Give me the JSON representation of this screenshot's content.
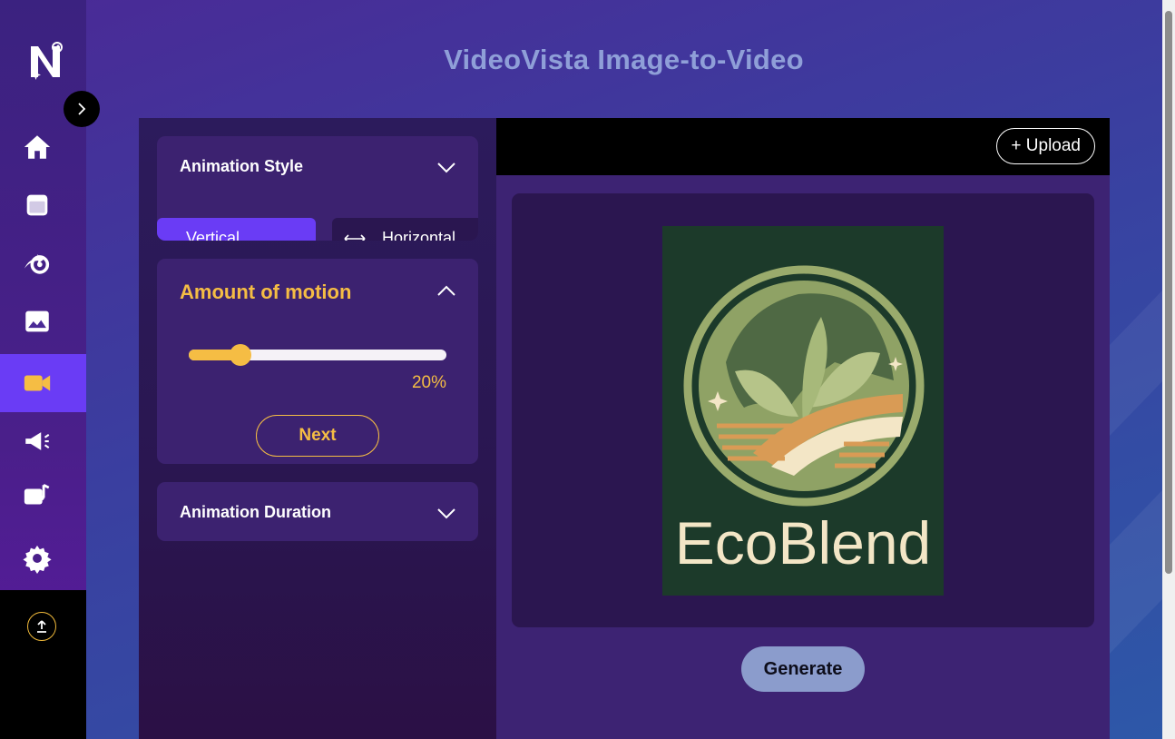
{
  "app": {
    "title": "VideoVista Image-to-Video"
  },
  "sidebar": {
    "items": [
      {
        "icon": "home-icon"
      },
      {
        "icon": "calendar-icon"
      },
      {
        "icon": "automation-gear-icon"
      },
      {
        "icon": "image-icon"
      },
      {
        "icon": "video-camera-icon",
        "active": true
      },
      {
        "icon": "megaphone-icon"
      },
      {
        "icon": "music-notes-icon"
      },
      {
        "icon": "settings-gear-icon"
      }
    ],
    "bottom_icon": "upload-icon"
  },
  "panels": {
    "animation_style": {
      "title": "Animation Style",
      "options": [
        "Vertical",
        "Horizontal"
      ],
      "selected": "Vertical"
    },
    "motion": {
      "title": "Amount of motion",
      "value": 0.2,
      "value_label": "20%",
      "next_label": "Next"
    },
    "duration": {
      "title": "Animation Duration"
    }
  },
  "preview": {
    "upload_label": "+ Upload",
    "image_text": "EcoBlend",
    "generate_label": "Generate"
  },
  "colors": {
    "accent": "#6a3cf5",
    "highlight": "#f5bd44",
    "card": "#3c2270",
    "generate": "#8b9ccc"
  }
}
